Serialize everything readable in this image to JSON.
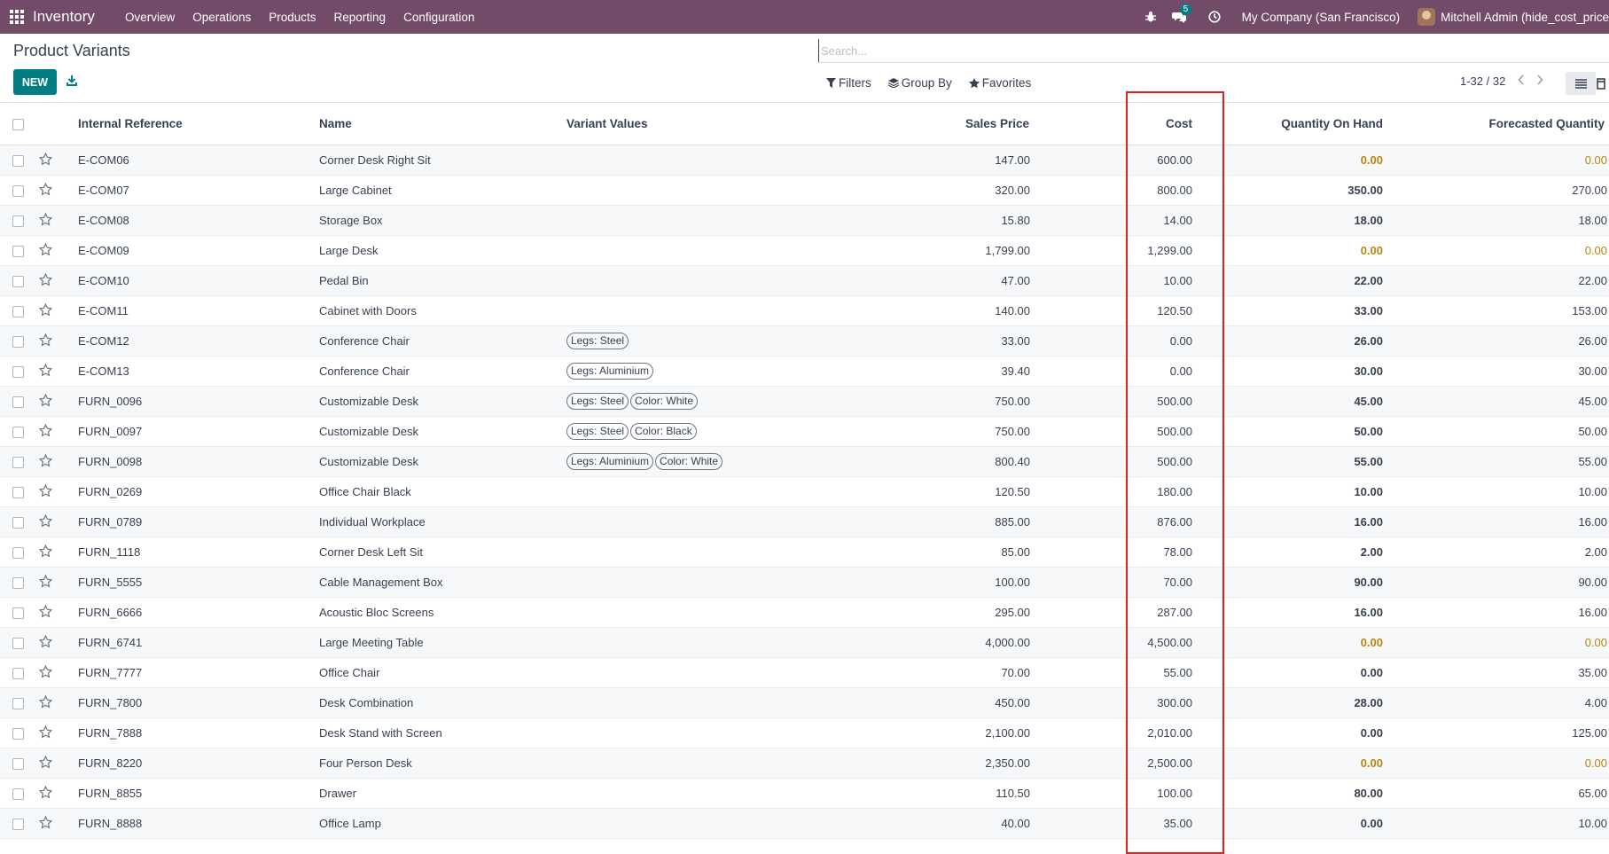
{
  "navbar": {
    "app_name": "Inventory",
    "menu": [
      "Overview",
      "Operations",
      "Products",
      "Reporting",
      "Configuration"
    ],
    "chat_badge": "5",
    "company": "My Company (San Francisco)",
    "user": "Mitchell Admin (hide_cost_price"
  },
  "control_panel": {
    "title": "Product Variants",
    "new_label": "NEW",
    "search_placeholder": "Search...",
    "filters_label": "Filters",
    "groupby_label": "Group By",
    "favorites_label": "Favorites",
    "pager": "1-32 / 32"
  },
  "table": {
    "headers": {
      "ref": "Internal Reference",
      "name": "Name",
      "variants": "Variant Values",
      "price": "Sales Price",
      "cost": "Cost",
      "qty": "Quantity On Hand",
      "forecast": "Forecasted Quantity"
    },
    "rows": [
      {
        "ref": "E-COM06",
        "name": "Corner Desk Right Sit",
        "variants": [],
        "price": "147.00",
        "cost": "600.00",
        "qty": "0.00",
        "forecast": "0.00",
        "warn": true
      },
      {
        "ref": "E-COM07",
        "name": "Large Cabinet",
        "variants": [],
        "price": "320.00",
        "cost": "800.00",
        "qty": "350.00",
        "forecast": "270.00",
        "warn": false
      },
      {
        "ref": "E-COM08",
        "name": "Storage Box",
        "variants": [],
        "price": "15.80",
        "cost": "14.00",
        "qty": "18.00",
        "forecast": "18.00",
        "warn": false
      },
      {
        "ref": "E-COM09",
        "name": "Large Desk",
        "variants": [],
        "price": "1,799.00",
        "cost": "1,299.00",
        "qty": "0.00",
        "forecast": "0.00",
        "warn": true
      },
      {
        "ref": "E-COM10",
        "name": "Pedal Bin",
        "variants": [],
        "price": "47.00",
        "cost": "10.00",
        "qty": "22.00",
        "forecast": "22.00",
        "warn": false
      },
      {
        "ref": "E-COM11",
        "name": "Cabinet with Doors",
        "variants": [],
        "price": "140.00",
        "cost": "120.50",
        "qty": "33.00",
        "forecast": "153.00",
        "warn": false
      },
      {
        "ref": "E-COM12",
        "name": "Conference Chair",
        "variants": [
          "Legs: Steel"
        ],
        "price": "33.00",
        "cost": "0.00",
        "qty": "26.00",
        "forecast": "26.00",
        "warn": false
      },
      {
        "ref": "E-COM13",
        "name": "Conference Chair",
        "variants": [
          "Legs: Aluminium"
        ],
        "price": "39.40",
        "cost": "0.00",
        "qty": "30.00",
        "forecast": "30.00",
        "warn": false
      },
      {
        "ref": "FURN_0096",
        "name": "Customizable Desk",
        "variants": [
          "Legs: Steel",
          "Color: White"
        ],
        "price": "750.00",
        "cost": "500.00",
        "qty": "45.00",
        "forecast": "45.00",
        "warn": false
      },
      {
        "ref": "FURN_0097",
        "name": "Customizable Desk",
        "variants": [
          "Legs: Steel",
          "Color: Black"
        ],
        "price": "750.00",
        "cost": "500.00",
        "qty": "50.00",
        "forecast": "50.00",
        "warn": false
      },
      {
        "ref": "FURN_0098",
        "name": "Customizable Desk",
        "variants": [
          "Legs: Aluminium",
          "Color: White"
        ],
        "price": "800.40",
        "cost": "500.00",
        "qty": "55.00",
        "forecast": "55.00",
        "warn": false
      },
      {
        "ref": "FURN_0269",
        "name": "Office Chair Black",
        "variants": [],
        "price": "120.50",
        "cost": "180.00",
        "qty": "10.00",
        "forecast": "10.00",
        "warn": false
      },
      {
        "ref": "FURN_0789",
        "name": "Individual Workplace",
        "variants": [],
        "price": "885.00",
        "cost": "876.00",
        "qty": "16.00",
        "forecast": "16.00",
        "warn": false
      },
      {
        "ref": "FURN_1118",
        "name": "Corner Desk Left Sit",
        "variants": [],
        "price": "85.00",
        "cost": "78.00",
        "qty": "2.00",
        "forecast": "2.00",
        "warn": false
      },
      {
        "ref": "FURN_5555",
        "name": "Cable Management Box",
        "variants": [],
        "price": "100.00",
        "cost": "70.00",
        "qty": "90.00",
        "forecast": "90.00",
        "warn": false
      },
      {
        "ref": "FURN_6666",
        "name": "Acoustic Bloc Screens",
        "variants": [],
        "price": "295.00",
        "cost": "287.00",
        "qty": "16.00",
        "forecast": "16.00",
        "warn": false
      },
      {
        "ref": "FURN_6741",
        "name": "Large Meeting Table",
        "variants": [],
        "price": "4,000.00",
        "cost": "4,500.00",
        "qty": "0.00",
        "forecast": "0.00",
        "warn": true
      },
      {
        "ref": "FURN_7777",
        "name": "Office Chair",
        "variants": [],
        "price": "70.00",
        "cost": "55.00",
        "qty": "0.00",
        "forecast": "35.00",
        "warn": false
      },
      {
        "ref": "FURN_7800",
        "name": "Desk Combination",
        "variants": [],
        "price": "450.00",
        "cost": "300.00",
        "qty": "28.00",
        "forecast": "4.00",
        "warn": false
      },
      {
        "ref": "FURN_7888",
        "name": "Desk Stand with Screen",
        "variants": [],
        "price": "2,100.00",
        "cost": "2,010.00",
        "qty": "0.00",
        "forecast": "125.00",
        "warn": false
      },
      {
        "ref": "FURN_8220",
        "name": "Four Person Desk",
        "variants": [],
        "price": "2,350.00",
        "cost": "2,500.00",
        "qty": "0.00",
        "forecast": "0.00",
        "warn": true
      },
      {
        "ref": "FURN_8855",
        "name": "Drawer",
        "variants": [],
        "price": "110.50",
        "cost": "100.00",
        "qty": "80.00",
        "forecast": "65.00",
        "warn": false
      },
      {
        "ref": "FURN_8888",
        "name": "Office Lamp",
        "variants": [],
        "price": "40.00",
        "cost": "35.00",
        "qty": "0.00",
        "forecast": "10.00",
        "warn": false
      }
    ]
  },
  "colors": {
    "navbar": "#714b67",
    "primary": "#017e84",
    "warning": "#b8860b",
    "highlight": "#e02020"
  }
}
